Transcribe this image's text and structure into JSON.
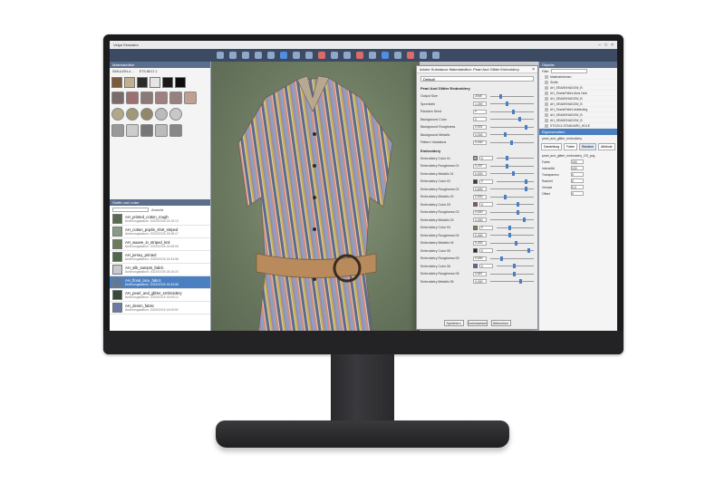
{
  "app": {
    "title": "Vidya Simulator",
    "window_buttons": [
      "–",
      "□",
      "×"
    ]
  },
  "left_panel": {
    "header": "Materialeditor",
    "fabric_tabs": [
      "SIMULEIN-4…",
      "ETS-BELT-1"
    ]
  },
  "library": {
    "header": "Stoffe und Leder",
    "view_label": "Ansicht",
    "items": [
      {
        "name": "AH_printed_cotton_rough",
        "date": "Änderungsdatum: 2022/02/26 15:19:13"
      },
      {
        "name": "AH_cotton_poplin_shirt_striped",
        "date": "Änderungsdatum: 2022/02/26 15:08:17"
      },
      {
        "name": "AH_waave_in_striped_knit",
        "date": "Änderungsdatum: 2022/02/26 16:08:05"
      },
      {
        "name": "AH_jersey_printed",
        "date": "Änderungsdatum: 2022/02/26 16:34:56"
      },
      {
        "name": "AH_silk_sampst_fabric",
        "date": "Änderungsdatum: 2022/02/26 18:16:23"
      },
      {
        "name": "AH_floral_lace_fabric",
        "date": "Änderungsdatum: 2022/02/26 16:34:58"
      },
      {
        "name": "AH_pearl_and_glitter_embroidery",
        "date": "Änderungsdatum: 2022/02/15 16:09:12"
      },
      {
        "name": "AH_denim_fabric",
        "date": "Änderungsdatum: 2022/02/15 16:09:52"
      }
    ],
    "selected_index": 5
  },
  "dialog": {
    "title": "Adobe Substance Materialeditor: Pearl And Glitter Embroidery",
    "preset": "Default",
    "section1": "Pearl And Glitter Embroidery",
    "section2": "Embroidery",
    "params": [
      {
        "label": "Output Size",
        "value": "2048"
      },
      {
        "label": "Sprenkeln",
        "value": "1,000"
      },
      {
        "label": "Random Seed",
        "value": "0"
      },
      {
        "label": "Background Color",
        "value": "0"
      },
      {
        "label": "Background Roughness",
        "value": "0,501"
      },
      {
        "label": "Background Metallic",
        "value": "0,000"
      },
      {
        "label": "Pattern Variations",
        "value": "0,000"
      }
    ],
    "embroidery_params": [
      {
        "label": "Embroidery Color 01",
        "value": "0",
        "color": "#b0a494"
      },
      {
        "label": "Embroidery Roughness 01",
        "value": "0,297"
      },
      {
        "label": "Embroidery Metallic 01",
        "value": "0,000"
      },
      {
        "label": "Embroidery Color 02",
        "value": "0",
        "color": "#3a3a3a"
      },
      {
        "label": "Embroidery Roughness 02",
        "value": "0,600"
      },
      {
        "label": "Embroidery Metallic 02",
        "value": "0,000"
      },
      {
        "label": "Embroidery Color 03",
        "value": "0",
        "color": "#9a5050"
      },
      {
        "label": "Embroidery Roughness 03",
        "value": "0,500"
      },
      {
        "label": "Embroidery Metallic 03",
        "value": "0,000"
      },
      {
        "label": "Embroidery Color 04",
        "value": "0",
        "color": "#8c8040"
      },
      {
        "label": "Embroidery Roughness 04",
        "value": "0,400"
      },
      {
        "label": "Embroidery Metallic 04",
        "value": "0,400"
      },
      {
        "label": "Embroidery Color 05",
        "value": "0",
        "color": "#2a2a2a"
      },
      {
        "label": "Embroidery Roughness 05",
        "value": "0,500"
      },
      {
        "label": "Embroidery Color 06",
        "value": "0",
        "color": "#5a6aa0"
      },
      {
        "label": "Embroidery Roughness 06",
        "value": "0,667"
      },
      {
        "label": "Embroidery Metallic 06",
        "value": "0,000"
      }
    ],
    "buttons": [
      "Speichern",
      "Zurücksetzen",
      "Abbrechen"
    ]
  },
  "right_panel": {
    "header": "Objekte",
    "filter_label": "Filter",
    "items": [
      "Materialebenen",
      "Stoffe",
      "AH_SEAMSHADOW_B",
      "AH_ShankPallet-Alow Hole",
      "AH_SEAMSHADOW_B",
      "AH_SEAMSHADOW_B",
      "AH_ShankPallet-Ireldesling",
      "AH_SEAMSHADOW_B",
      "AH_SEAMSHADOW_B",
      "STOCK4 STANDARD_HOLE"
    ],
    "properties_header": "Eigenschaften",
    "material_name": "pearl_and_glitter_embroidery",
    "tabs": [
      "Darstellung",
      "Farbe",
      "Rendern",
      "Attribute"
    ],
    "active_tab": 2,
    "texture_file": "pearl_and_glitter_embroidery_GS_png",
    "fields": [
      {
        "label": "Farbe",
        "value": "100"
      },
      {
        "label": "Intensität",
        "value": "100"
      },
      {
        "label": "Transparenz",
        "value": "0"
      },
      {
        "label": "Rauheit",
        "value": "0"
      },
      {
        "label": "Versatz",
        "value": "0,0"
      },
      {
        "label": "Offset",
        "value": "0"
      }
    ]
  }
}
